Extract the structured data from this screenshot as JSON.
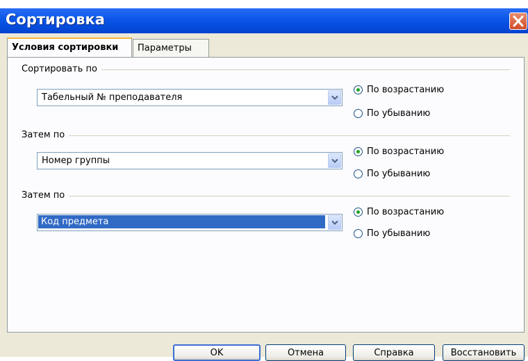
{
  "window": {
    "title": "Сортировка",
    "close_icon": "close-x-icon"
  },
  "tabs": [
    {
      "label": "Условия сортировки",
      "active": true
    },
    {
      "label": "Параметры",
      "active": false
    }
  ],
  "sort_groups": [
    {
      "label": "Сортировать по",
      "field_value": "Табельный  № преподавателя",
      "ascending_label": "По возрастанию",
      "descending_label": "По убыванию",
      "selected_order": "ascending",
      "highlighted": false
    },
    {
      "label": "Затем по",
      "field_value": "Номер группы",
      "ascending_label": "По возрастанию",
      "descending_label": "По убыванию",
      "selected_order": "ascending",
      "highlighted": false
    },
    {
      "label": "Затем по",
      "field_value": "Код предмета",
      "ascending_label": "По возрастанию",
      "descending_label": "По убыванию",
      "selected_order": "ascending",
      "highlighted": true
    }
  ],
  "buttons": {
    "ok": "OK",
    "cancel": "Отмена",
    "help": "Справка",
    "reset": "Восстановить"
  },
  "colors": {
    "titlebar": "#0a55e8",
    "dialog_bg": "#ece9d8",
    "selection": "#316ac5",
    "radio_dot": "#21a121",
    "close_button": "#d34a26"
  }
}
